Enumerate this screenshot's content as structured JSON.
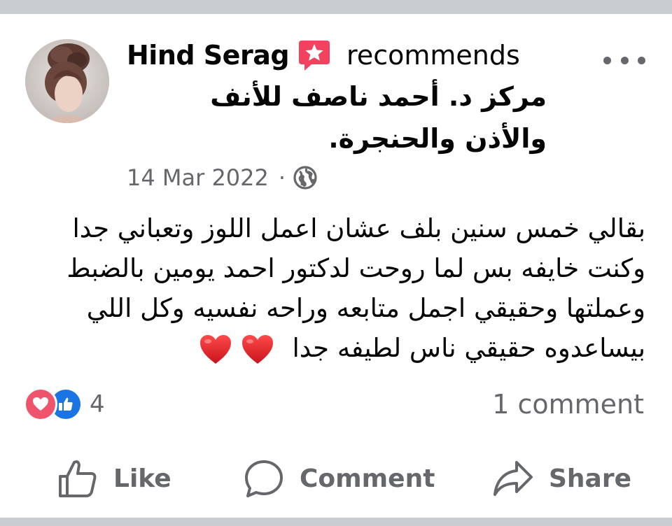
{
  "post": {
    "author": "Hind Serag",
    "verb": "recommends",
    "place": "مركز د. أحمد ناصف للأنف والأذن والحنجرة.",
    "date": "14 Mar 2022",
    "separator": "·",
    "privacy_icon": "globe-icon",
    "body": "بقالي خمس سنين بلف عشان اعمل اللوز وتعباني جدا وكنت خايفه بس لما روحت لدكتور احمد يومين بالضبط وعملتها وحقيقي اجمل متابعه وراحه نفسيه وكل اللي بيساعدوه حقيقي ناس لطيفه جدا",
    "emoji": [
      "heart-emoji",
      "heart-emoji"
    ]
  },
  "stats": {
    "reaction_icons": [
      "love-reaction-icon",
      "like-reaction-icon"
    ],
    "reaction_count": "4",
    "comment_count": "1 comment"
  },
  "actions": {
    "like": "Like",
    "comment": "Comment",
    "share": "Share"
  },
  "colors": {
    "secondary_text": "#65676b",
    "love": "#f0536c",
    "like_blue": "#1b74e4",
    "recommend_badge": "#f3425f",
    "divider_bar": "#c9ccd1"
  }
}
